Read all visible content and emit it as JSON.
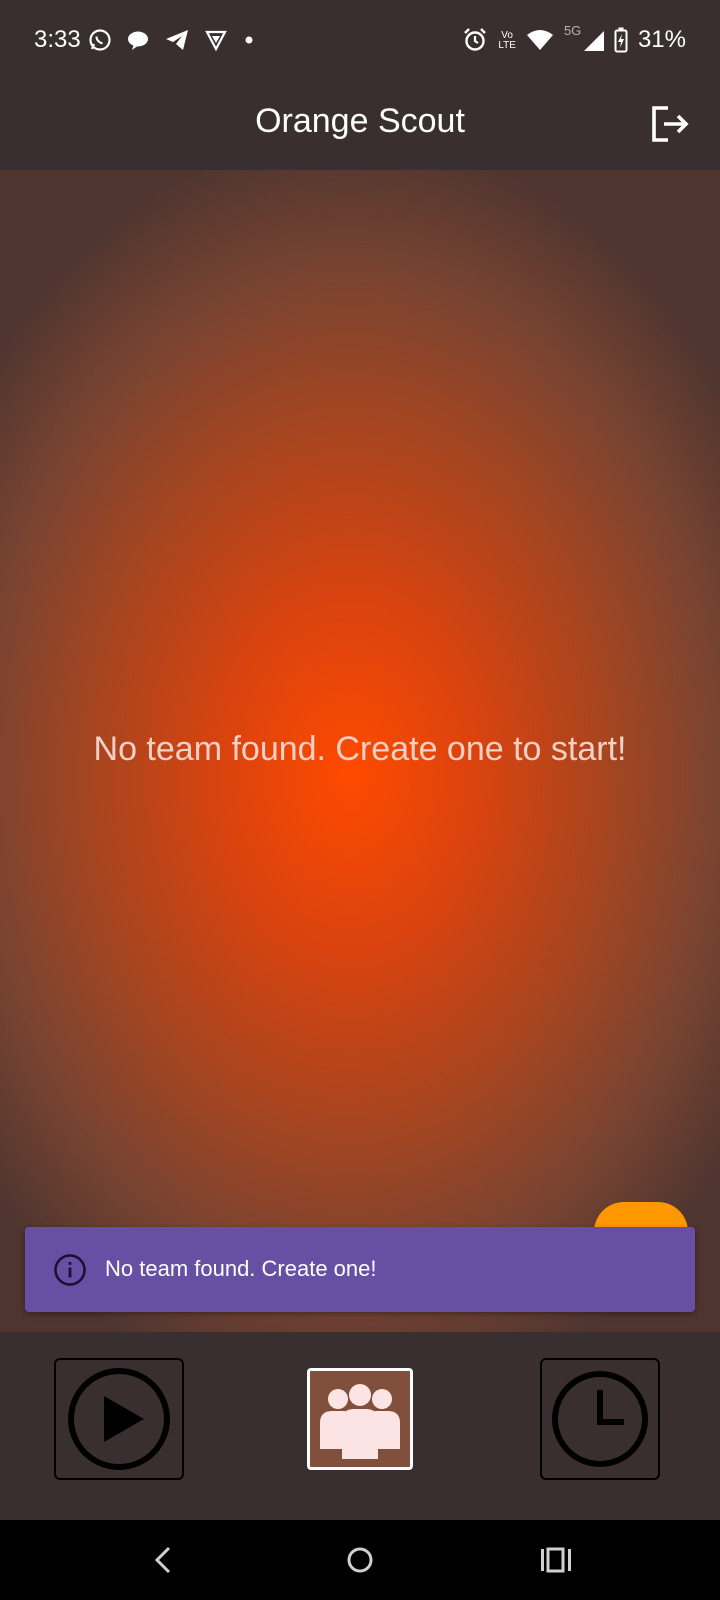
{
  "status_bar": {
    "time": "3:33",
    "left_icons": [
      "whatsapp-icon",
      "chat-bubble-icon",
      "telegram-icon",
      "vpn-shield-icon",
      "notification-dot-icon"
    ],
    "right_icons": [
      "alarm-icon",
      "volte-icon",
      "wifi-icon",
      "signal-icon",
      "battery-charging-icon"
    ],
    "volte_top": "Vo",
    "volte_bottom": "LTE",
    "network": "5G",
    "battery": "31%"
  },
  "app_bar": {
    "title": "Orange Scout",
    "logout_icon": "logout-icon"
  },
  "main": {
    "empty_message": "No team found. Create one to start!",
    "fab_color": "#ff9800"
  },
  "snackbar": {
    "icon": "info-icon",
    "message": "No team found. Create one!",
    "background": "#6750a4"
  },
  "bottom_nav": {
    "items": [
      {
        "name": "play",
        "icon": "play-icon",
        "selected": false
      },
      {
        "name": "team",
        "icon": "team-icon",
        "selected": true
      },
      {
        "name": "history",
        "icon": "clock-icon",
        "selected": false
      }
    ]
  },
  "colors": {
    "background": "#3a2f30",
    "accent": "#ff4a00",
    "team_tile": "#80503c"
  }
}
